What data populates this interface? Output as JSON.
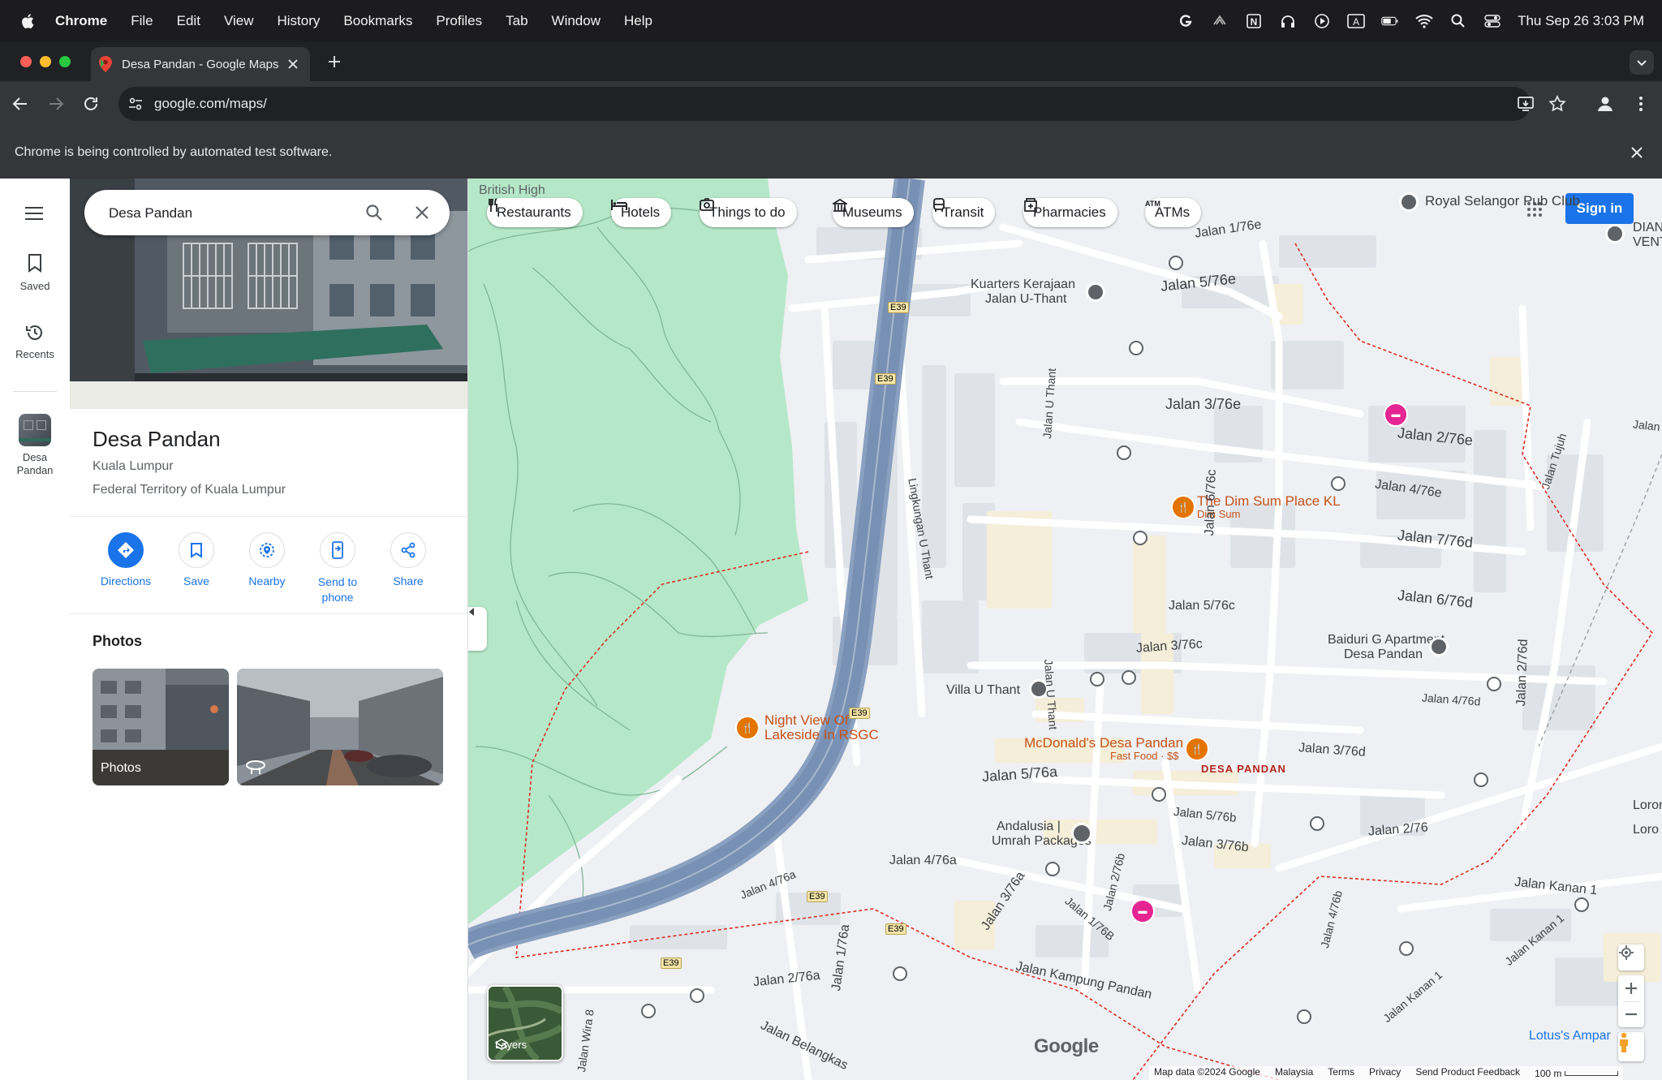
{
  "menubar": {
    "app": "Chrome",
    "items": [
      "File",
      "Edit",
      "View",
      "History",
      "Bookmarks",
      "Profiles",
      "Tab",
      "Window",
      "Help"
    ],
    "clock": "Thu Sep 26  3:03 PM"
  },
  "browser": {
    "tab_title": "Desa Pandan - Google Maps",
    "url": "google.com/maps/",
    "infobar": "Chrome is being controlled by automated test software."
  },
  "rail": {
    "saved": "Saved",
    "recents": "Recents",
    "recent_place": "Desa Pandan"
  },
  "search": {
    "value": "Desa Pandan"
  },
  "place": {
    "name": "Desa Pandan",
    "line1": "Kuala Lumpur",
    "line2": "Federal Territory of Kuala Lumpur"
  },
  "actions": {
    "directions": "Directions",
    "save": "Save",
    "nearby": "Nearby",
    "send_to_phone": "Send to phone",
    "share": "Share"
  },
  "photos": {
    "heading": "Photos",
    "tile1_label": "Photos"
  },
  "chips": [
    "Restaurants",
    "Hotels",
    "Things to do",
    "Museums",
    "Transit",
    "Pharmacies",
    "ATMs"
  ],
  "map": {
    "sign_in": "Sign in",
    "layers": "Layers",
    "brand": "Google",
    "footer": [
      "Map data ©2024 Google",
      "Malaysia",
      "Terms",
      "Privacy",
      "Send Product Feedback",
      "100 m"
    ],
    "labels": {
      "british": "British High",
      "royal": "Royal Selangor Pub Club",
      "dian": "DIAN",
      "vent": "VENT",
      "kuarters1": "Kuarters Kerajaan",
      "kuarters2": "Jalan U-Thant",
      "dimsum": "The Dim Sum Place KL",
      "dimsum_sub": "Dim Sum",
      "baiduri1": "Baiduri G Apartment",
      "baiduri2": "Desa Pandan",
      "villa": "Villa U Thant",
      "mcd": "McDonald's Desa Pandan",
      "mcd_sub": "Fast Food · $$",
      "desa_area": "DESA PANDAN",
      "night1": "Night View Of",
      "night2": "Lakeside In RSGC",
      "andalusia1": "Andalusia |",
      "andalusia2": "Umrah Packages",
      "lotus": "Lotus's Ampar",
      "e39": "E39"
    },
    "roads": {
      "j1_76e": "Jalan 1/76e",
      "j5_76e": "Jalan 5/76e",
      "j3_76e": "Jalan 3/76e",
      "j2_76e": "Jalan 2/76e",
      "j4_76e": "Jalan 4/76e",
      "j7_76d": "Jalan 7/76d",
      "j6_76d": "Jalan 6/76d",
      "j6_76c": "Jalan 6/76c",
      "j5_76c": "Jalan 5/76c",
      "j3_76c": "Jalan 3/76c",
      "j2_76d": "Jalan 2/76d",
      "j4_76d": "Jalan 4/76d",
      "j3_76d": "Jalan 3/76d",
      "j5_76a": "Jalan 5/76a",
      "j5_76b": "Jalan 5/76b",
      "j3_76b": "Jalan 3/76b",
      "j2_76": "Jalan 2/76",
      "j4_76a": "Jalan 4/76a",
      "j4_76a2": "Jalan 4/76a",
      "j1_76a": "Jalan 1/76a",
      "j3_76a": "Jalan 3/76a",
      "j2_76b": "Jalan 2/76b",
      "j1_76b": "Jalan 1/76B",
      "j4_76b": "Jalan 4/76b",
      "j2_76a": "Jalan 2/76a",
      "kampung": "Jalan Kampung Pandan",
      "kanan1a": "Jalan Kanan 1",
      "kanan1b": "Jalan Kanan 1",
      "kanan1c": "Jalan Kanan 1",
      "belangkas": "Jalan Belangkas",
      "wira": "Jalan Wira 8",
      "lingkungan": "Lingkungan U Thant",
      "uthant1": "Jalan U Thant",
      "uthant2": "Jalan U Thant",
      "tujuh": "Jalan Tujuh",
      "lima": "Jalan Lima",
      "loron": "Loron",
      "loro2": "Loro"
    }
  }
}
